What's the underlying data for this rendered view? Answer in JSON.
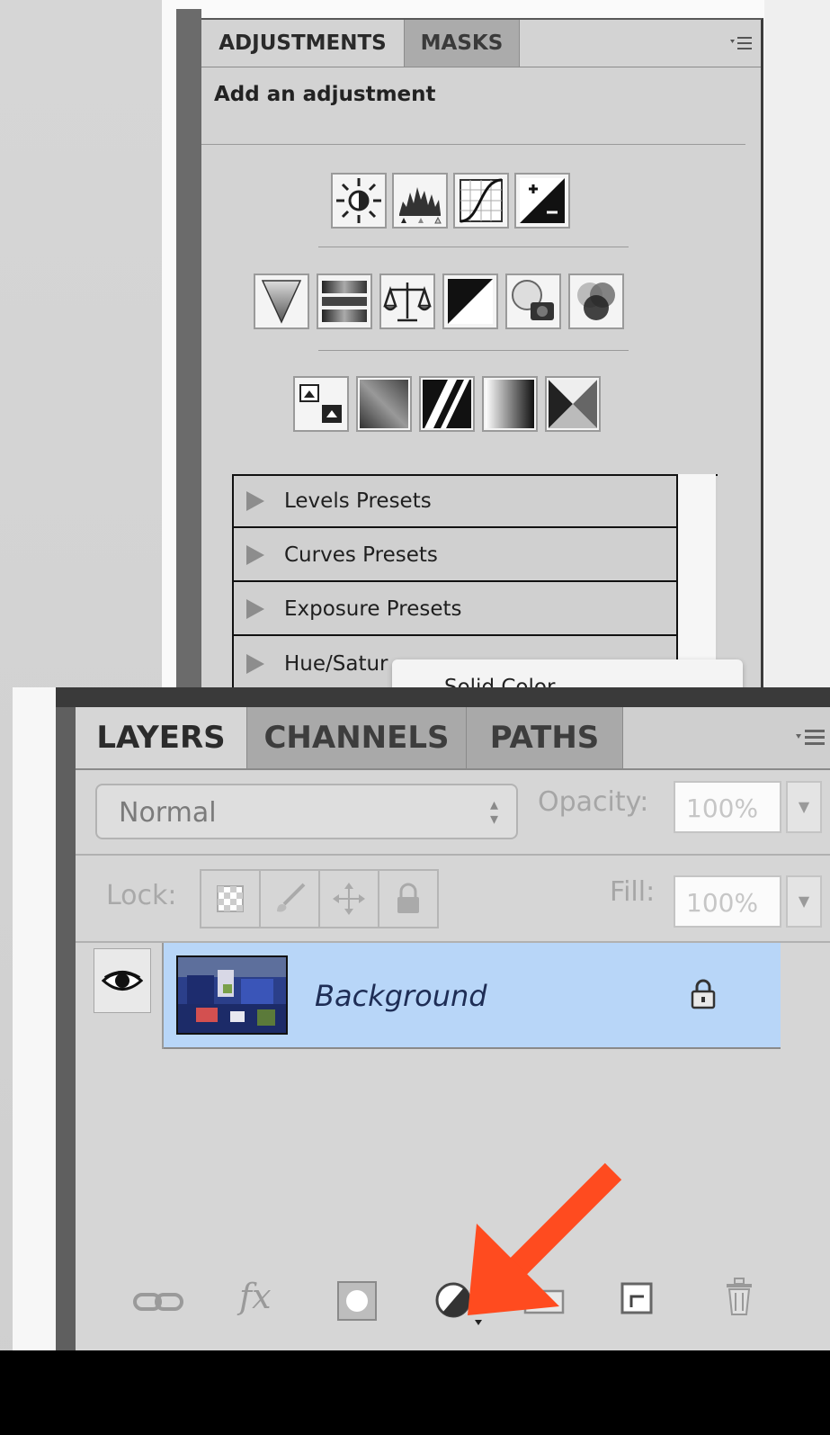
{
  "adjustments_panel": {
    "tabs": [
      {
        "label": "ADJUSTMENTS",
        "active": true
      },
      {
        "label": "MASKS",
        "active": false
      }
    ],
    "menu_icon": "panel-menu-icon",
    "subtitle": "Add an adjustment",
    "icon_rows": [
      [
        "brightness-contrast-icon",
        "levels-icon",
        "curves-icon",
        "exposure-icon"
      ],
      [
        "vibrance-icon",
        "hue-saturation-icon",
        "color-balance-icon",
        "black-white-icon",
        "photo-filter-icon",
        "channel-mixer-icon"
      ],
      [
        "invert-icon",
        "posterize-icon",
        "threshold-icon",
        "gradient-map-icon",
        "selective-color-icon"
      ]
    ],
    "presets": [
      "Levels Presets",
      "Curves Presets",
      "Exposure Presets",
      "Hue/Satur"
    ]
  },
  "popup_menu": {
    "item_label": "Solid Color"
  },
  "layers_panel": {
    "tabs": [
      {
        "label": "LAYERS",
        "active": true
      },
      {
        "label": "CHANNELS",
        "active": false
      },
      {
        "label": "PATHS",
        "active": false
      }
    ],
    "blend_mode": "Normal",
    "opacity_label": "Opacity:",
    "opacity_value": "100%",
    "lock_label": "Lock:",
    "fill_label": "Fill:",
    "fill_value": "100%",
    "layers": [
      {
        "name": "Background",
        "visible": true,
        "locked": true,
        "selected": true
      }
    ],
    "bottom_icons": [
      "link-layers-icon",
      "fx-icon",
      "add-mask-icon",
      "new-adjustment-layer-icon",
      "new-group-icon",
      "new-layer-icon",
      "delete-layer-icon"
    ],
    "fx_label": "fx"
  },
  "colors": {
    "selection": "#b8d6f8",
    "annotation_arrow": "#ff4b1f"
  }
}
